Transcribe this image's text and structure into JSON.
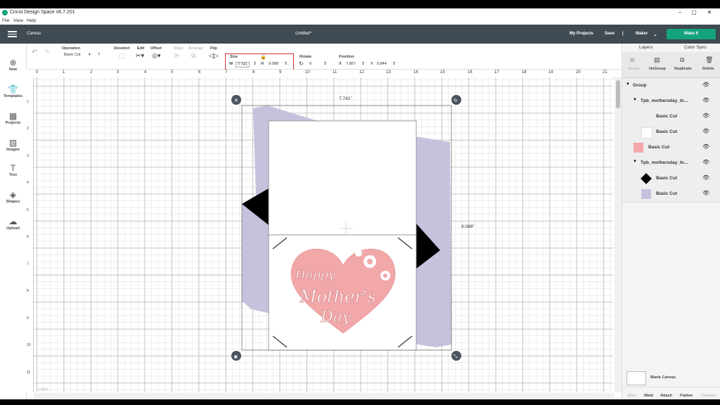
{
  "window": {
    "title": "Cricut Design Space  v6.7.201",
    "min": "‒",
    "max": "▢",
    "close": "✕"
  },
  "menu": {
    "file": "File",
    "view": "View",
    "help": "Help"
  },
  "header": {
    "section": "Canvas",
    "doc_title": "Untitled*",
    "my_projects": "My Projects",
    "save": "Save",
    "sep": "|",
    "machine": "Maker",
    "make_it": "Make It"
  },
  "toolbar": {
    "undo_icon": "↶",
    "redo_icon": "↷",
    "operation_label": "Operation",
    "operation_value": "Basic Cut",
    "operation_help": "?",
    "deselect": "Deselect",
    "edit": "Edit",
    "offset": "Offset",
    "align": "Align",
    "arrange": "Arrange",
    "flip": "Flip",
    "size_label": "Size",
    "w_label": "W",
    "w_value": "7.741",
    "h_label": "H",
    "h_value": "9.088",
    "rotate_label": "Rotate",
    "rotate_value": "0",
    "position_label": "Position",
    "x_label": "X",
    "x_value": "7.867",
    "y_label": "Y",
    "y_value": "0.844"
  },
  "sidebar": [
    "New",
    "Templates",
    "Projects",
    "Images",
    "Text",
    "Shapes",
    "Upload"
  ],
  "ruler_h": [
    "0",
    "1",
    "2",
    "3",
    "4",
    "5",
    "6",
    "7",
    "8",
    "9",
    "10",
    "11",
    "12",
    "13",
    "14",
    "15",
    "16",
    "17",
    "18",
    "19",
    "20",
    "21"
  ],
  "ruler_v": [
    "1",
    "2",
    "3",
    "4",
    "5",
    "6",
    "7",
    "8",
    "9",
    "10",
    "11"
  ],
  "canvas": {
    "width_label": "7.741\"",
    "height_label": "9.088\"",
    "zoom": "100%"
  },
  "card_text": {
    "line1": "Happy",
    "line2": "Mother's",
    "line3": "Day"
  },
  "colors": {
    "lavender": "#c6c1dd",
    "pink": "#f2a7a9",
    "teal": "#14a37a",
    "header": "#3f4a53"
  },
  "panel": {
    "tab_layers": "Layers",
    "tab_color_sync": "Color Sync",
    "actions": [
      "Group",
      "UnGroup",
      "Duplicate",
      "Delete"
    ],
    "layers": [
      {
        "name": "Group"
      },
      {
        "name": "Tpb_mothersday_In..."
      },
      {
        "name": "Basic Cut"
      },
      {
        "name": "Basic Cut"
      },
      {
        "name": "Basic Cut"
      },
      {
        "name": "Tpb_mothersday_In..."
      },
      {
        "name": "Basic Cut"
      },
      {
        "name": "Basic Cut"
      }
    ],
    "blank_canvas": "Blank Canvas",
    "bottom": [
      "Slice",
      "Weld",
      "Attach",
      "Flatten",
      "Contour"
    ]
  }
}
